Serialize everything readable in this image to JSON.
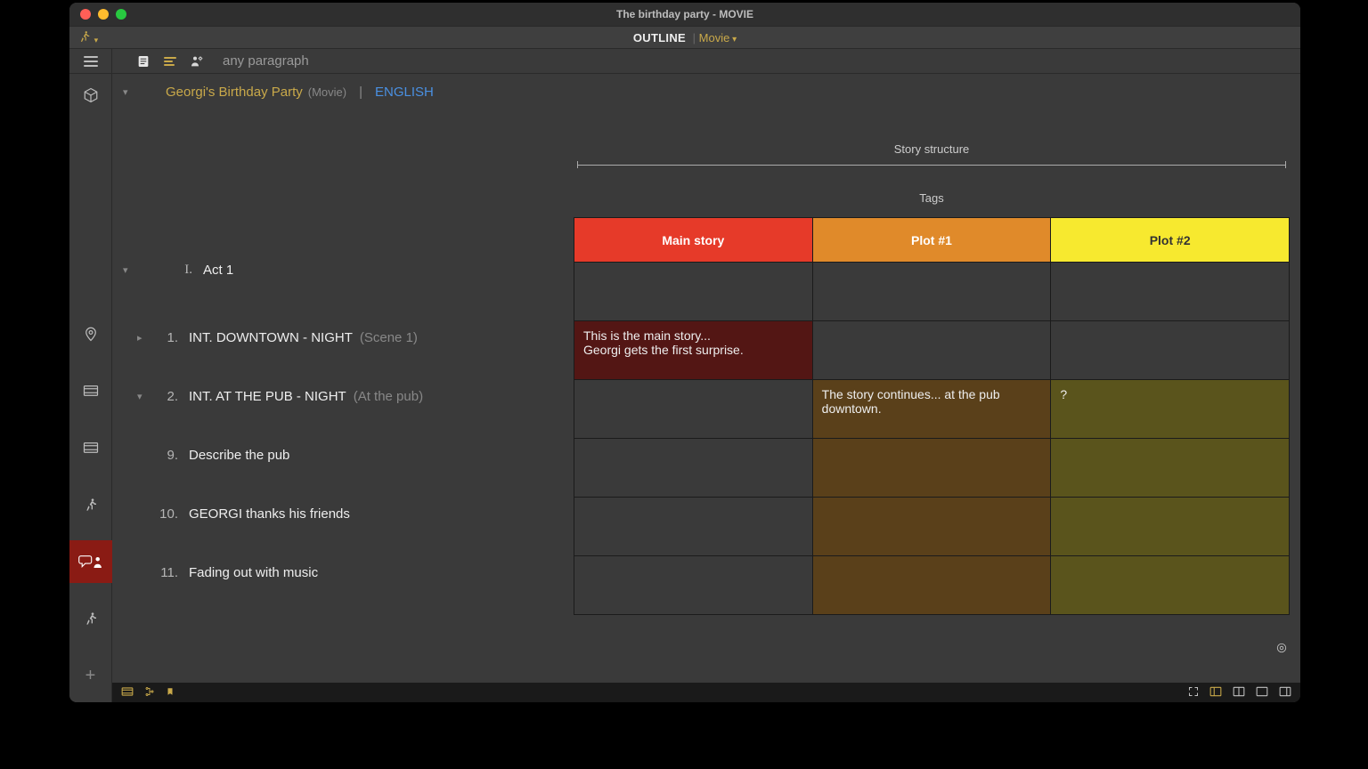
{
  "window": {
    "title": "The birthday party - MOVIE"
  },
  "modebar": {
    "label": "OUTLINE",
    "mode": "Movie"
  },
  "toolbar": {
    "search_placeholder": "any paragraph"
  },
  "header": {
    "project_title": "Georgi's Birthday Party",
    "project_type": "(Movie)",
    "language": "ENGLISH"
  },
  "story_structure_label": "Story structure",
  "tags_label": "Tags",
  "tag_columns": {
    "main": "Main story",
    "plot1": "Plot #1",
    "plot2": "Plot #2"
  },
  "outline": [
    {
      "num": "I.",
      "text": "Act 1",
      "sub": "",
      "chev": "down",
      "roman": true
    },
    {
      "num": "1.",
      "text": "INT.  DOWNTOWN - NIGHT",
      "sub": "(Scene 1)",
      "chev": "right"
    },
    {
      "num": "2.",
      "text": "INT.  AT THE PUB - NIGHT",
      "sub": "(At the pub)",
      "chev": "down"
    },
    {
      "num": "9.",
      "text": "Describe the pub",
      "sub": "",
      "chev": ""
    },
    {
      "num": "10.",
      "text": "GEORGI thanks his friends",
      "sub": "",
      "chev": ""
    },
    {
      "num": "11.",
      "text": "Fading out with music",
      "sub": "",
      "chev": ""
    }
  ],
  "cells": {
    "r1": {
      "main": "This is the main story...\nGeorgi gets the first surprise.",
      "p1": "",
      "p2": ""
    },
    "r2": {
      "main": "",
      "p1": "The story continues... at the pub downtown.",
      "p2": "?"
    }
  }
}
